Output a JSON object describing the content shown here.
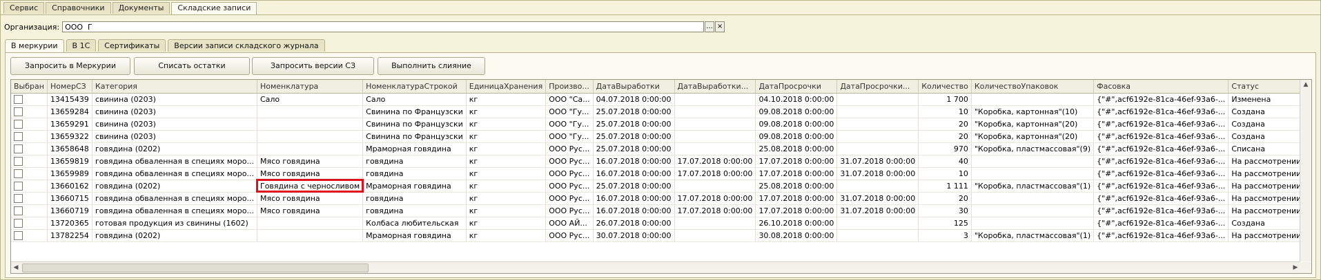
{
  "top_tabs": [
    "Сервис",
    "Справочники",
    "Документы",
    "Складские записи"
  ],
  "organization": {
    "label": "Организация:",
    "value": "ООО  Г",
    "select_btn": "...",
    "clear_btn": "×"
  },
  "sub_tabs": [
    "В меркурии",
    "В 1С",
    "Сертификаты",
    "Версии записи складского журнала"
  ],
  "buttons": {
    "request_mercury": "Запросить в Меркурии",
    "write_off": "Списать остатки",
    "request_versions": "Запросить версии СЗ",
    "merge": "Выполнить слияние"
  },
  "table": {
    "columns": [
      "Выбран",
      "НомерСЗ",
      "Категория",
      "Номенклатура",
      "НоменклатураСтрокой",
      "ЕдиницаХранения",
      "Произво...",
      "ДатаВыработки",
      "ДатаВыработки...",
      "ДатаПросрочки",
      "ДатаПросрочки...",
      "Количество",
      "КоличествоУпаковок",
      "Фасовка",
      "Статус"
    ],
    "rows": [
      [
        "",
        "13415439",
        "свинина (0203)",
        "Сало",
        "Сало",
        "кг",
        "ООО \"Са...",
        "04.07.2018 0:00:00",
        "",
        "04.10.2018 0:00:00",
        "",
        "1 700",
        "",
        "{\"#\",acf6192e-81ca-46ef-93a6-...",
        "Изменена"
      ],
      [
        "",
        "13659284",
        "свинина (0203)",
        "",
        "Свинина по Французски",
        "кг",
        "ООО \"Гу...",
        "25.07.2018 0:00:00",
        "",
        "09.08.2018 0:00:00",
        "",
        "10",
        "\"Коробка, картонная\"(10)",
        "{\"#\",acf6192e-81ca-46ef-93a6-...",
        "Создана"
      ],
      [
        "",
        "13659291",
        "свинина (0203)",
        "",
        "Свинина по Французски",
        "кг",
        "ООО \"Гу...",
        "25.07.2018 0:00:00",
        "",
        "09.08.2018 0:00:00",
        "",
        "20",
        "\"Коробка, картонная\"(20)",
        "{\"#\",acf6192e-81ca-46ef-93a6-...",
        "Создана"
      ],
      [
        "",
        "13659322",
        "свинина (0203)",
        "",
        "Свинина по Французски",
        "кг",
        "ООО \"Гу...",
        "25.07.2018 0:00:00",
        "",
        "09.08.2018 0:00:00",
        "",
        "20",
        "\"Коробка, картонная\"(20)",
        "{\"#\",acf6192e-81ca-46ef-93a6-...",
        "Создана"
      ],
      [
        "",
        "13658648",
        "говядина (0202)",
        "",
        "Мраморная говядина",
        "кг",
        "ООО Рус...",
        "25.07.2018 0:00:00",
        "",
        "25.08.2018 0:00:00",
        "",
        "970",
        "\"Коробка, пластмассовая\"(9)",
        "{\"#\",acf6192e-81ca-46ef-93a6-...",
        "Списана"
      ],
      [
        "",
        "13659819",
        "говядина обваленная в специях моро...",
        "Мясо говядина",
        "говядина",
        "кг",
        "ООО Рус...",
        "16.07.2018 0:00:00",
        "17.07.2018 0:00:00",
        "17.07.2018 0:00:00",
        "31.07.2018 0:00:00",
        "40",
        "",
        "{\"#\",acf6192e-81ca-46ef-93a6-...",
        "На рассмотрении в В..."
      ],
      [
        "",
        "13659989",
        "говядина обваленная в специях моро...",
        "Мясо говядина",
        "говядина",
        "кг",
        "ООО Рус...",
        "16.07.2018 0:00:00",
        "17.07.2018 0:00:00",
        "17.07.2018 0:00:00",
        "31.07.2018 0:00:00",
        "10",
        "",
        "{\"#\",acf6192e-81ca-46ef-93a6-...",
        "На рассмотрении в В..."
      ],
      [
        "",
        "13660162",
        "говядина (0202)",
        "Говядина с черносливом",
        "Мраморная говядина",
        "кг",
        "ООО Рус...",
        "25.07.2018 0:00:00",
        "",
        "25.08.2018 0:00:00",
        "",
        "1 111",
        "\"Коробка, пластмассовая\"(1)",
        "{\"#\",acf6192e-81ca-46ef-93a6-...",
        "На рассмотрении в В..."
      ],
      [
        "",
        "13660715",
        "говядина обваленная в специях моро...",
        "Мясо говядина",
        "говядина",
        "кг",
        "ООО Рус...",
        "16.07.2018 0:00:00",
        "17.07.2018 0:00:00",
        "17.07.2018 0:00:00",
        "31.07.2018 0:00:00",
        "20",
        "",
        "{\"#\",acf6192e-81ca-46ef-93a6-...",
        "На рассмотрении в В..."
      ],
      [
        "",
        "13660719",
        "говядина обваленная в специях моро...",
        "Мясо говядина",
        "говядина",
        "кг",
        "ООО Рус...",
        "16.07.2018 0:00:00",
        "17.07.2018 0:00:00",
        "17.07.2018 0:00:00",
        "31.07.2018 0:00:00",
        "30",
        "",
        "{\"#\",acf6192e-81ca-46ef-93a6-...",
        "На рассмотрении в В..."
      ],
      [
        "",
        "13720365",
        "готовая продукция из свинины (1602)",
        "",
        "Колбаса любительская",
        "кг",
        "ООО АЙ...",
        "26.07.2018 0:00:00",
        "",
        "26.10.2018 0:00:00",
        "",
        "125",
        "",
        "{\"#\",acf6192e-81ca-46ef-93a6-...",
        "Создана"
      ],
      [
        "",
        "13782254",
        "говядина (0202)",
        "",
        "Мраморная говядина",
        "кг",
        "ООО Рус...",
        "30.07.2018 0:00:00",
        "",
        "30.08.2018 0:00:00",
        "",
        "3",
        "\"Коробка, пластмассовая\"(1)",
        "{\"#\",acf6192e-81ca-46ef-93a6-...",
        "На рассмотрении в В..."
      ]
    ],
    "highlighted_cell": {
      "row": 7,
      "col": 3
    }
  },
  "colors": {
    "highlight": "#e0111b",
    "background": "#f5f3dc"
  }
}
